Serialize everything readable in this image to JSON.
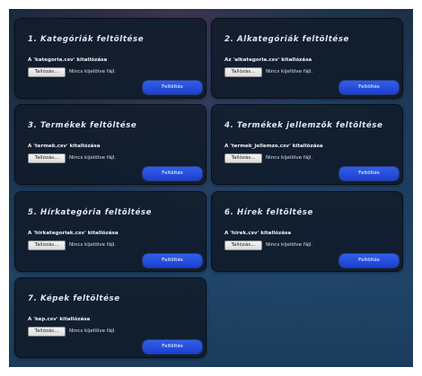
{
  "cards": [
    {
      "title": "1. Kategóriák feltöltése",
      "label": "A 'kategoria.csv' kitallózása",
      "browse": "Tallózás...",
      "status": "Nincs kijelölve fájl.",
      "upload": "Feltöltés"
    },
    {
      "title": "2. Alkategóriák feltöltése",
      "label": "Az 'alkategoria.csv' kitallózása",
      "browse": "Tallózás...",
      "status": "Nincs kijelölve fájl.",
      "upload": "Feltöltés"
    },
    {
      "title": "3. Termékek feltöltése",
      "label": "A 'termek.csv' kitallózása",
      "browse": "Tallózás...",
      "status": "Nincs kijelölve fájl.",
      "upload": "Feltöltés"
    },
    {
      "title": "4. Termékek jellemzők feltöltése",
      "label": "A 'termek_jellemzo.csv' kitallózása",
      "browse": "Tallózás...",
      "status": "Nincs kijelölve fájl.",
      "upload": "Feltöltés"
    },
    {
      "title": "5. Hírkategória feltöltése",
      "label": "A 'hirkategoriak.csv' kitallózása",
      "browse": "Tallózás...",
      "status": "Nincs kijelölve fájl.",
      "upload": "Feltöltés"
    },
    {
      "title": "6. Hírek feltöltése",
      "label": "A 'hirek.csv' kitallózása",
      "browse": "Tallózás...",
      "status": "Nincs kijelölve fájl.",
      "upload": "Feltöltés"
    },
    {
      "title": "7. Képek feltöltése",
      "label": "A 'kep.csv' kitallózása",
      "browse": "Tallózás...",
      "status": "Nincs kijelölve fájl.",
      "upload": "Feltöltés"
    }
  ],
  "colors": {
    "accent": "#2f5fe8",
    "card_bg": "#121d2c",
    "title_text": "#dde7f5"
  }
}
